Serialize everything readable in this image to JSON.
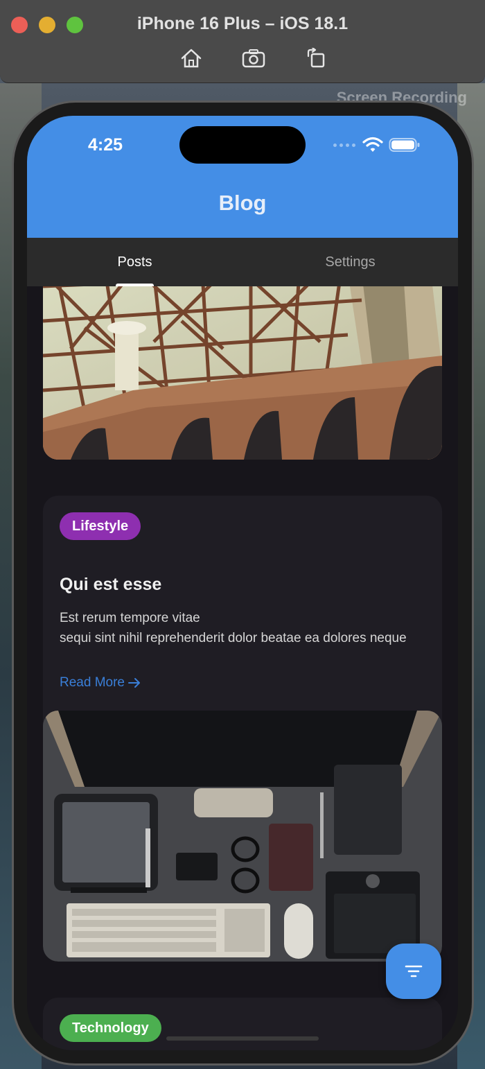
{
  "simulator": {
    "title": "iPhone 16 Plus – iOS 18.1",
    "tools": [
      "home-icon",
      "screenshot-icon",
      "rotate-icon"
    ]
  },
  "desktop": {
    "watermark": "Screen Recording"
  },
  "status_bar": {
    "time": "4:25"
  },
  "app_bar": {
    "title": "Blog",
    "color": "#448ee6"
  },
  "tabs": [
    {
      "label": "Posts",
      "active": true
    },
    {
      "label": "Settings",
      "active": false
    }
  ],
  "posts": [
    {
      "category": "Lifestyle",
      "category_color": "#8e2fb0",
      "title": "Qui est esse",
      "body_line1": "Est rerum tempore vitae",
      "body_line2": "sequi sint nihil reprehenderit dolor beatae ea dolores neque",
      "read_more": "Read More"
    },
    {
      "category": "Technology",
      "category_color": "#4caf50"
    }
  ],
  "fab": {
    "icon": "filter-icon"
  }
}
